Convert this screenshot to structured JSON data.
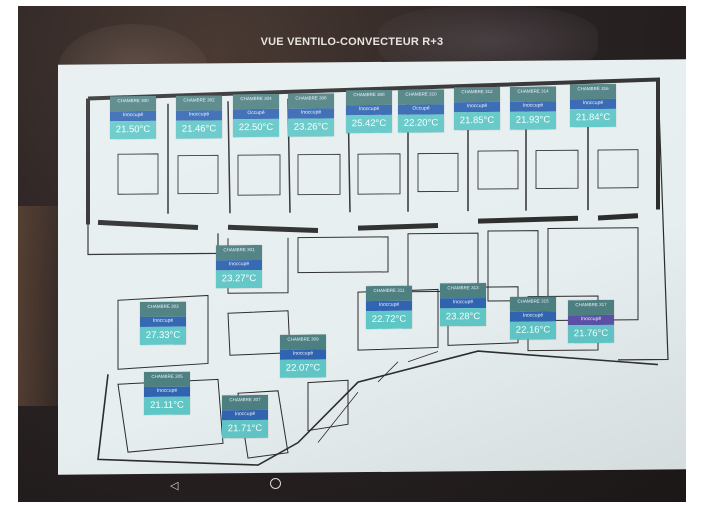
{
  "screen": {
    "title": "VUE VENTILO-CONVECTEUR R+3"
  },
  "colors": {
    "header": "#4c7f80",
    "status": "#2f63b0",
    "temp": "#5fc6c6",
    "screen_bg": "#e6eef0"
  },
  "rooms": [
    {
      "label": "CHAMBRE 300",
      "status": "Inoccupé",
      "temp": "21.50°C"
    },
    {
      "label": "CHAMBRE 302",
      "status": "Inoccupé",
      "temp": "21.46°C"
    },
    {
      "label": "CHAMBRE 304",
      "status": "Occupé",
      "temp": "22.50°C"
    },
    {
      "label": "CHAMBRE 306",
      "status": "Inoccupé",
      "temp": "23.26°C"
    },
    {
      "label": "CHAMBRE 308",
      "status": "Inoccupé",
      "temp": "25.42°C"
    },
    {
      "label": "CHAMBRE 310",
      "status": "Occupé",
      "temp": "22.20°C"
    },
    {
      "label": "CHAMBRE 312",
      "status": "Inoccupé",
      "temp": "21.85°C"
    },
    {
      "label": "CHAMBRE 314",
      "status": "Inoccupé",
      "temp": "21.93°C"
    },
    {
      "label": "CHAMBRE 316",
      "status": "Inoccupé",
      "temp": "21.84°C"
    },
    {
      "label": "CHAMBRE 301",
      "status": "Inoccupé",
      "temp": "23.27°C"
    },
    {
      "label": "CHAMBRE 303",
      "status": "Inoccupé",
      "temp": "27.33°C"
    },
    {
      "label": "CHAMBRE 311",
      "status": "Inoccupé",
      "temp": "22.72°C"
    },
    {
      "label": "CHAMBRE 313",
      "status": "Inoccupé",
      "temp": "23.28°C"
    },
    {
      "label": "CHAMBRE 315",
      "status": "Inoccupé",
      "temp": "22.16°C"
    },
    {
      "label": "CHAMBRE 317",
      "status": "Inoccupé",
      "temp": "21.76°C"
    },
    {
      "label": "CHAMBRE 309",
      "status": "Inoccupé",
      "temp": "22.07°C"
    },
    {
      "label": "CHAMBRE 305",
      "status": "Inoccupé",
      "temp": "21.11°C"
    },
    {
      "label": "CHAMBRE 307",
      "status": "Inoccupé",
      "temp": "21.71°C"
    }
  ],
  "navigation": {
    "back_icon": "back-triangle-icon",
    "home_icon": "home-circle-icon"
  }
}
